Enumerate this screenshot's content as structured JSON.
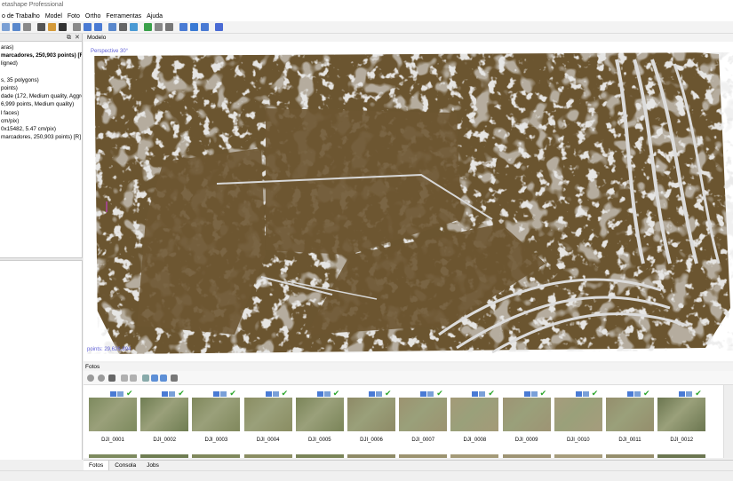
{
  "window": {
    "title": "etashape Professional"
  },
  "menu": [
    "o de Trabalho",
    "Model",
    "Foto",
    "Ortho",
    "Ferramentas",
    "Ajuda"
  ],
  "toolbar_icons": [
    "new-icon",
    "chunk-icon",
    "navigation-icon",
    "ruler-icon",
    "brush-icon",
    "close-icon",
    "crop-icon",
    "zoom-in-icon",
    "zoom-out-icon",
    "move-icon",
    "view-options-icon",
    "select-icon",
    "color-icon",
    "image-icon",
    "layers-icon",
    "shape-icon",
    "flag-icon",
    "mask-icon",
    "globe-icon"
  ],
  "left_panel": {
    "tree": [
      "aras)",
      " marcadores, 250,903 points) [R",
      "ligned)",
      "",
      "s, 35 polygons)",
      " points)",
      "dade (172, Medium quality, Aggre",
      "6,999 points, Medium quality)",
      "l faces)",
      "cm/pix)",
      "0x15482, 5.47 cm/pix)",
      " marcadores, 250,903 points) [R]"
    ]
  },
  "model": {
    "tab_label": "Modelo",
    "projection": "Perspective 30°",
    "points_info": "points: 29,626,894"
  },
  "photos": {
    "panel_label": "Fotos",
    "items": [
      {
        "name": "DJI_0001",
        "color": "#7d8a5e"
      },
      {
        "name": "DJI_0002",
        "color": "#6f7d52"
      },
      {
        "name": "DJI_0003",
        "color": "#80885c"
      },
      {
        "name": "DJI_0004",
        "color": "#8a8d62"
      },
      {
        "name": "DJI_0005",
        "color": "#7a8458"
      },
      {
        "name": "DJI_0006",
        "color": "#8e8a66"
      },
      {
        "name": "DJI_0007",
        "color": "#9c9370"
      },
      {
        "name": "DJI_0008",
        "color": "#a49a78"
      },
      {
        "name": "DJI_0009",
        "color": "#9e9474"
      },
      {
        "name": "DJI_0010",
        "color": "#a69c7c"
      },
      {
        "name": "DJI_0011",
        "color": "#958e6c"
      },
      {
        "name": "DJI_0012",
        "color": "#6b7650"
      }
    ]
  },
  "bottom_tabs": [
    "Fotos",
    "Consola",
    "Jobs"
  ],
  "colors": {
    "terrain": "#6b5530",
    "structures": "#d4d4d4",
    "check": "#2aa52a",
    "badge": "#4a7bd4"
  }
}
